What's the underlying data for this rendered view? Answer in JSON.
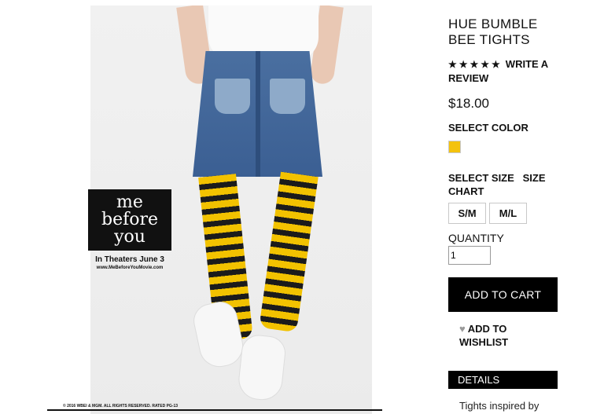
{
  "product": {
    "title": "HUE BUMBLE BEE TIGHTS",
    "rating_stars": "★★★★★",
    "rating": 5,
    "write_review": "WRITE A REVIEW",
    "price": "$18.00"
  },
  "color": {
    "label": "SELECT COLOR",
    "swatch_color": "#f4c20d"
  },
  "size": {
    "label": "SELECT SIZE",
    "chart_link": "SIZE CHART",
    "options": [
      "S/M",
      "M/L"
    ]
  },
  "quantity": {
    "label": "QUANTITY",
    "value": "1"
  },
  "actions": {
    "add_to_cart": "ADD TO CART",
    "wishlist_icon": "♥",
    "add_to_wishlist": "ADD TO WISHLIST"
  },
  "details": {
    "heading": "DETAILS",
    "text": "Tights inspired by"
  },
  "promo": {
    "logo_text_1": "me",
    "logo_text_2": "before",
    "logo_text_3": "you",
    "line1": "In Theaters June 3",
    "line2": "www.MeBeforeYouMovie.com",
    "copyright": "© 2016 WBEI & MGM. ALL RIGHTS RESERVED. RATED PG-13"
  }
}
